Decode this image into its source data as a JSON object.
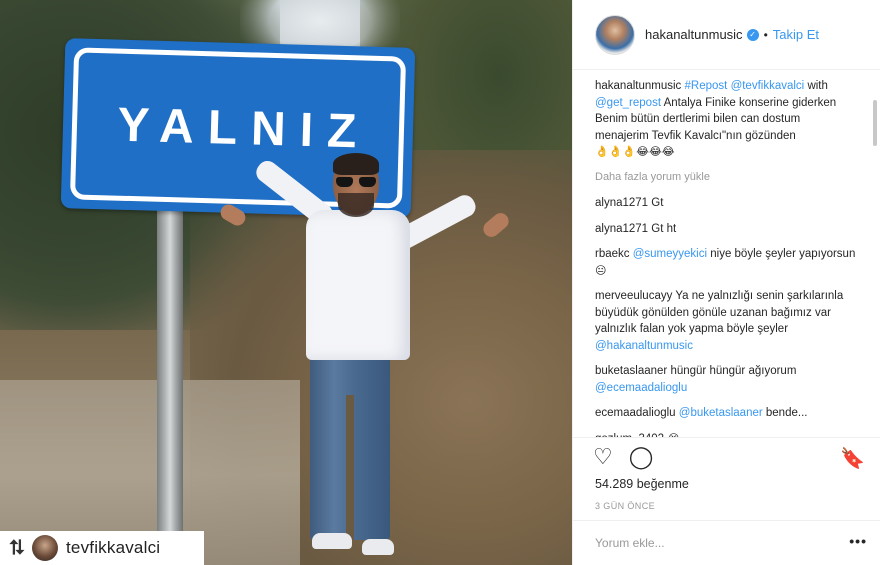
{
  "photo": {
    "sign_text": "YALNIZ",
    "repost_badge": {
      "icon": "repost-icon",
      "glyph": "⮁",
      "username": "tevfikkavalci"
    }
  },
  "header": {
    "username": "hakanaltunmusic",
    "verified_glyph": "✓",
    "separator": "•",
    "follow_label": "Takip Et"
  },
  "caption": {
    "user": "hakanaltunmusic",
    "tag_repost": "#Repost",
    "tag_user": "@tevfikkavalci",
    "word_with": "with",
    "tag_get_repost": "@get_repost",
    "text": "Antalya Finike konserine giderken Benim bütün dertlerimi bilen can dostum menajerim Tevfik Kavalcı\"nın gözünden",
    "emojis": "👌👌👌😂😂😂"
  },
  "load_more": "Daha fazla yorum yükle",
  "comments": [
    {
      "user": "alyna1271",
      "text": "Gt"
    },
    {
      "user": "alyna1271",
      "text": "Gt ht"
    },
    {
      "user": "rbaekc",
      "mention": "@sumeyyekici",
      "text": "niye böyle şeyler yapıyorsun",
      "emoji": "😐"
    },
    {
      "user": "merveeulucayy",
      "text": "Ya ne yalnızlığı senin şarkılarınla büyüdük gönülden gönüle uzanan bağımız var yalnızlık falan yok yapma böyle şeyler",
      "mention": "@hakanaltunmusic"
    },
    {
      "user": "buketaslaaner",
      "text": "hüngür hüngür ağıyorum",
      "mention": "@ecemaadalioglu"
    },
    {
      "user": "ecemaadalioglu",
      "mention": "@buketaslaaner",
      "text": "bende..."
    },
    {
      "user": "gozlum_3402",
      "emoji": "😭"
    }
  ],
  "actions": {
    "like_icon": "heart-icon",
    "like_glyph": "♡",
    "comment_icon": "comment-icon",
    "comment_glyph": "◯",
    "save_icon": "bookmark-icon",
    "save_glyph": "🔖"
  },
  "likes_text": "54.289 beğenme",
  "date_text": "3 GÜN ÖNCE",
  "add_comment": {
    "placeholder": "Yorum ekle...",
    "more_glyph": "•••"
  },
  "colors": {
    "accent": "#3897f0",
    "sign_blue": "#1f6fc6"
  }
}
